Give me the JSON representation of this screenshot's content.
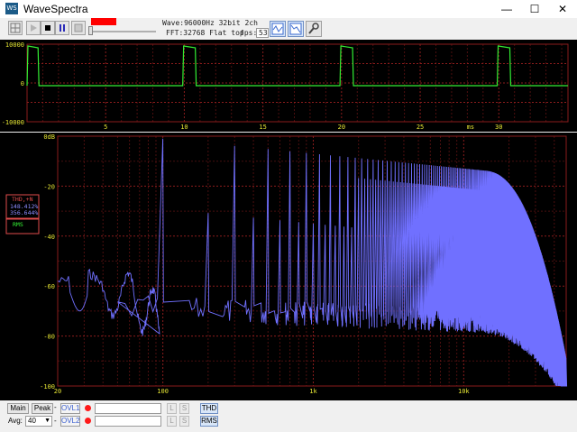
{
  "window": {
    "title": "WaveSpectra",
    "icon_text": "WS"
  },
  "toolbar": {
    "wave_info": "Wave:96000Hz 32bit 2ch",
    "fft_info": "FFT:32768 Flat top",
    "fps_label": "fps:",
    "fps_value": "53"
  },
  "scope": {
    "y_ticks": [
      "10000",
      "0",
      "-10000"
    ],
    "x_ticks": [
      "5",
      "10",
      "15",
      "20",
      "25",
      "30"
    ],
    "x_unit": "ms"
  },
  "spectrum": {
    "y_ticks": [
      "0dB",
      "-20",
      "-40",
      "-60",
      "-80",
      "-100"
    ],
    "x_ticks": [
      "20",
      "100",
      "1k",
      "10k"
    ],
    "thd_label": "THD,+N",
    "thd_value1": "148.412%",
    "thd_value2": "356.644%",
    "rms_label": "RMS"
  },
  "bottom": {
    "main_label": "Main",
    "peak_label": "Peak",
    "avg_label": "Avg:",
    "avg_value": "40",
    "dash": "-",
    "ovl1_label": "OVL1",
    "ovl2_label": "OVL2",
    "l_label": "L",
    "s_label": "S",
    "thd_button": "THD",
    "rms_button": "RMS"
  },
  "colors": {
    "waveform": "#33ee33",
    "spectrum": "#7070ff",
    "grid": "#8a1c1c",
    "axis_text": "#e4e434",
    "spectrum_tick_text": "#e04c4c",
    "record": "#ff0000"
  }
}
